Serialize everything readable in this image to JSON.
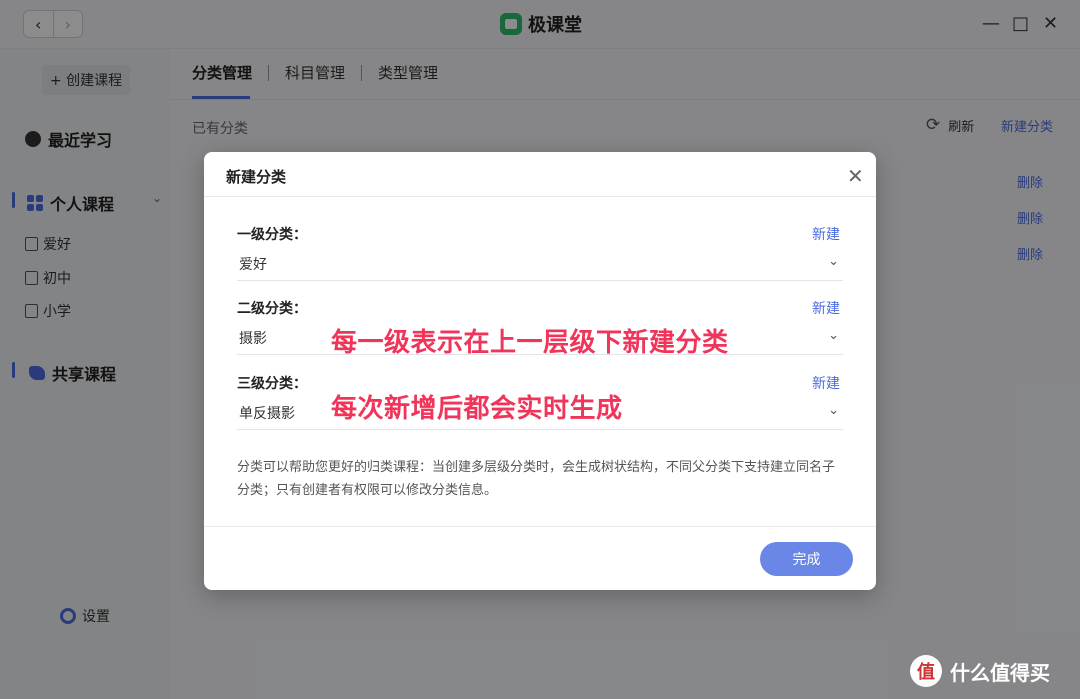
{
  "app": {
    "title": "极课堂"
  },
  "sidebar": {
    "create_label": "+ 创建课程",
    "recent_label": "最近学习",
    "personal_label": "个人课程",
    "personal_items": [
      "爱好",
      "初中",
      "小学"
    ],
    "shared_label": "共享课程",
    "settings_label": "设置"
  },
  "main": {
    "tabs": [
      "分类管理",
      "科目管理",
      "类型管理"
    ],
    "existing_label": "已有分类",
    "refresh_label": "刷新",
    "new_category_label": "新建分类",
    "delete_labels": [
      "删除",
      "删除",
      "删除"
    ]
  },
  "modal": {
    "title": "新建分类",
    "levels": [
      {
        "label": "一级分类：",
        "new_label": "新建",
        "value": "爱好"
      },
      {
        "label": "二级分类：",
        "new_label": "新建",
        "value": "摄影"
      },
      {
        "label": "三级分类：",
        "new_label": "新建",
        "value": "单反摄影"
      }
    ],
    "annotations": [
      "每一级表示在上一层级下新建分类",
      "每次新增后都会实时生成"
    ],
    "help_text": "分类可以帮助您更好的归类课程：当创建多层级分类时，会生成树状结构，不同父分类下支持建立同名子分类；只有创建者有权限可以修改分类信息。",
    "done_label": "完成"
  },
  "watermark": {
    "text": "什么值得买",
    "icon_text": "值"
  },
  "colors": {
    "accent": "#4b6cde",
    "annotation": "#f0345a",
    "done_button": "#6a86e6",
    "logo": "#2dbe6c"
  }
}
